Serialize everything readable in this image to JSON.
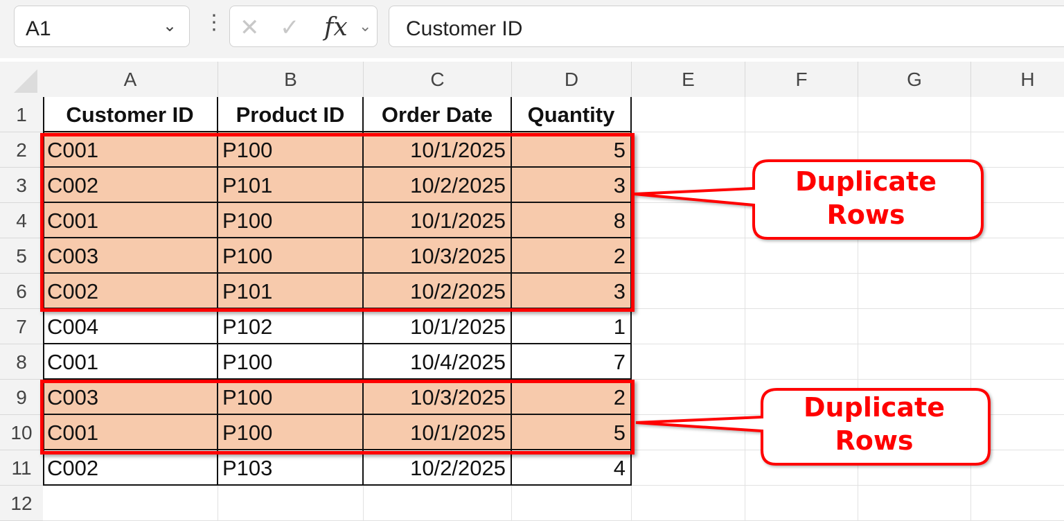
{
  "formula_bar": {
    "name_box": "A1",
    "formula": "Customer ID"
  },
  "columns": [
    "A",
    "B",
    "C",
    "D",
    "E",
    "F",
    "G",
    "H"
  ],
  "rows": [
    "1",
    "2",
    "3",
    "4",
    "5",
    "6",
    "7",
    "8",
    "9",
    "10",
    "11",
    "12"
  ],
  "table": {
    "headers": [
      "Customer ID",
      "Product ID",
      "Order Date",
      "Quantity"
    ],
    "rows": [
      [
        "C001",
        "P100",
        "10/1/2025",
        "5"
      ],
      [
        "C002",
        "P101",
        "10/2/2025",
        "3"
      ],
      [
        "C001",
        "P100",
        "10/1/2025",
        "8"
      ],
      [
        "C003",
        "P100",
        "10/3/2025",
        "2"
      ],
      [
        "C002",
        "P101",
        "10/2/2025",
        "3"
      ],
      [
        "C004",
        "P102",
        "10/1/2025",
        "1"
      ],
      [
        "C001",
        "P100",
        "10/4/2025",
        "7"
      ],
      [
        "C003",
        "P100",
        "10/3/2025",
        "2"
      ],
      [
        "C001",
        "P100",
        "10/1/2025",
        "5"
      ],
      [
        "C002",
        "P103",
        "10/2/2025",
        "4"
      ]
    ],
    "highlighted_rows": [
      0,
      1,
      2,
      3,
      4,
      7,
      8
    ]
  },
  "callouts": [
    {
      "line1": "Duplicate",
      "line2": "Rows"
    },
    {
      "line1": "Duplicate",
      "line2": "Rows"
    }
  ],
  "colors": {
    "highlight_fill": "#f7caac",
    "callout_red": "#ff0000"
  }
}
